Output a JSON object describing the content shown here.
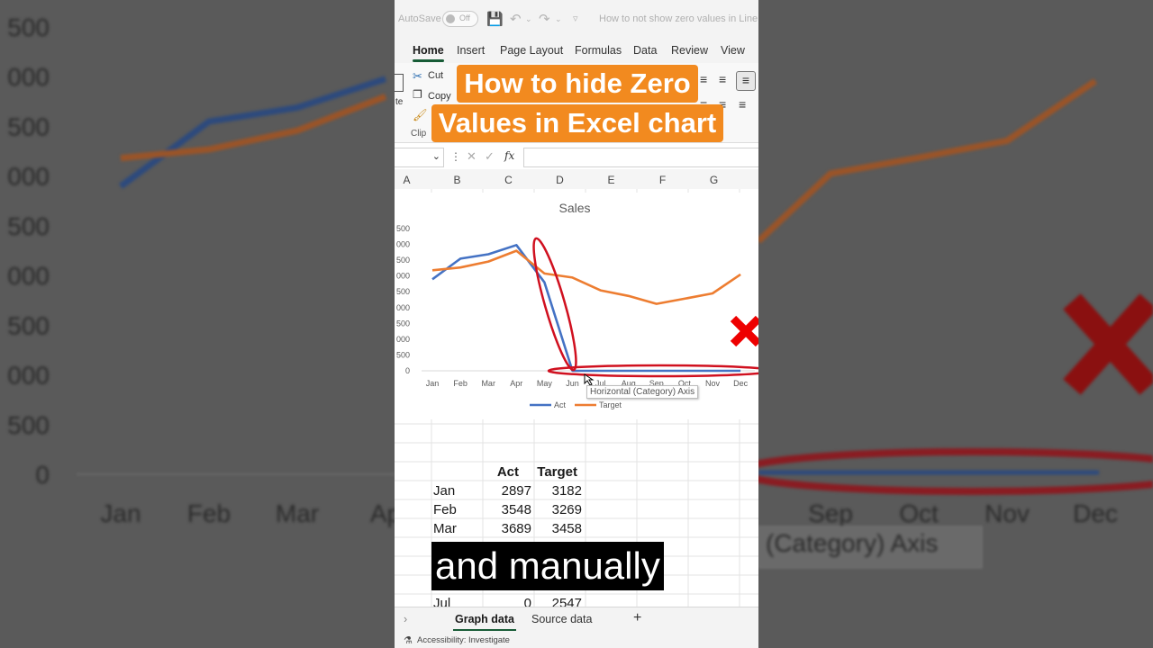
{
  "app": {
    "autosave_label": "AutoSave",
    "autosave_state": "Off",
    "document_title": "How to not show zero values in Line c"
  },
  "ribbon_tabs": [
    {
      "label": "Home",
      "active": true
    },
    {
      "label": "Insert",
      "active": false
    },
    {
      "label": "Page Layout",
      "active": false
    },
    {
      "label": "Formulas",
      "active": false
    },
    {
      "label": "Data",
      "active": false
    },
    {
      "label": "Review",
      "active": false
    },
    {
      "label": "View",
      "active": false
    }
  ],
  "ribbon": {
    "cut_label": "Cut",
    "copy_label": "Copy",
    "paste_fragment": "te",
    "clipboard_fragment": "Clip"
  },
  "headline": {
    "line1": "How to hide Zero",
    "line2": "Values in Excel chart"
  },
  "formula_bar": {
    "fx_label": "fx",
    "formula_value": ""
  },
  "columns": [
    "A",
    "B",
    "C",
    "D",
    "E",
    "F",
    "G"
  ],
  "chart_data": {
    "type": "line",
    "title": "Sales",
    "categories": [
      "Jan",
      "Feb",
      "Mar",
      "Apr",
      "May",
      "Jun",
      "Jul",
      "Aug",
      "Sep",
      "Oct",
      "Nov",
      "Dec"
    ],
    "series": [
      {
        "name": "Act",
        "color": "#4472c4",
        "values": [
          2897,
          3548,
          3689,
          3978,
          2800,
          0,
          0,
          0,
          0,
          0,
          0,
          0
        ]
      },
      {
        "name": "Target",
        "color": "#ed7d31",
        "values": [
          3182,
          3269,
          3458,
          3800,
          3080,
          2950,
          2547,
          2370,
          2120,
          2280,
          2450,
          3050
        ]
      }
    ],
    "ylim": [
      0,
      4500
    ],
    "y_ticks_visible": [
      "500",
      "000",
      "500",
      "000",
      "500",
      "000",
      "500",
      "000",
      "500",
      "0"
    ],
    "legend_position": "bottom"
  },
  "tooltip": "Horizontal (Category) Axis",
  "table": {
    "headers": [
      "Act",
      "Target"
    ],
    "rows": [
      {
        "month": "Jan",
        "act": "2897",
        "target": "3182"
      },
      {
        "month": "Feb",
        "act": "3548",
        "target": "3269"
      },
      {
        "month": "Mar",
        "act": "3689",
        "target": "3458"
      }
    ],
    "partial_row": {
      "month": "Jul",
      "act": "0",
      "target": "2547"
    }
  },
  "caption": "and manually",
  "sheet_tabs": [
    {
      "label": "Graph data",
      "active": true
    },
    {
      "label": "Source data",
      "active": false
    }
  ],
  "add_sheet_label": "+",
  "status": {
    "accessibility": "Accessibility: Investigate"
  },
  "background_zoom": {
    "y_labels": [
      "500",
      "000",
      "500",
      "000",
      "500",
      "000",
      "500",
      "000",
      "500",
      "0"
    ],
    "x_labels_left": [
      "Jan",
      "Feb",
      "Mar",
      "Ap"
    ],
    "x_labels_right": [
      "Sep",
      "Oct",
      "Nov",
      "Dec"
    ],
    "axis_label_fragment": "(Category) Axis"
  },
  "colors": {
    "act": "#4472c4",
    "target": "#ed7d31",
    "highlight": "#d0101f",
    "headline_bg": "#f28a1f",
    "excel_green": "#185c37"
  }
}
